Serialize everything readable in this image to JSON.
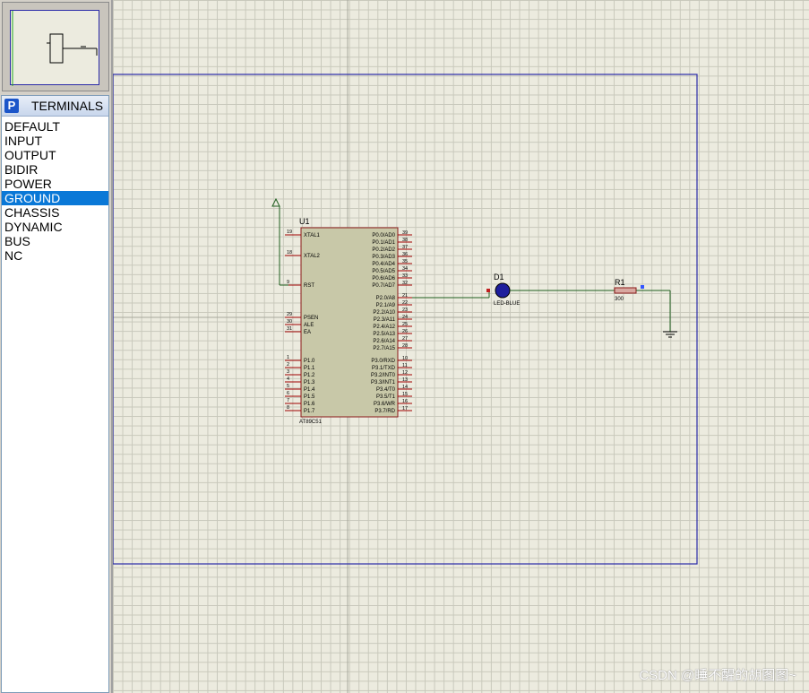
{
  "terminals_panel": {
    "mode_button": "P",
    "title": "TERMINALS",
    "items": [
      "DEFAULT",
      "INPUT",
      "OUTPUT",
      "BIDIR",
      "POWER",
      "GROUND",
      "CHASSIS",
      "DYNAMIC",
      "BUS",
      "NC"
    ],
    "selected": "GROUND"
  },
  "schematic": {
    "u1": {
      "ref": "U1",
      "part": "AT89C51",
      "left_pins": [
        {
          "num": "19",
          "name": "XTAL1"
        },
        {
          "num": "18",
          "name": "XTAL2"
        },
        {
          "num": "9",
          "name": "RST"
        },
        {
          "num": "29",
          "name": "PSEN"
        },
        {
          "num": "30",
          "name": "ALE"
        },
        {
          "num": "31",
          "name": "EA"
        },
        {
          "num": "1",
          "name": "P1.0"
        },
        {
          "num": "2",
          "name": "P1.1"
        },
        {
          "num": "3",
          "name": "P1.2"
        },
        {
          "num": "4",
          "name": "P1.3"
        },
        {
          "num": "5",
          "name": "P1.4"
        },
        {
          "num": "6",
          "name": "P1.5"
        },
        {
          "num": "7",
          "name": "P1.6"
        },
        {
          "num": "8",
          "name": "P1.7"
        }
      ],
      "right_pins": [
        {
          "num": "39",
          "name": "P0.0/AD0"
        },
        {
          "num": "38",
          "name": "P0.1/AD1"
        },
        {
          "num": "37",
          "name": "P0.2/AD2"
        },
        {
          "num": "36",
          "name": "P0.3/AD3"
        },
        {
          "num": "35",
          "name": "P0.4/AD4"
        },
        {
          "num": "34",
          "name": "P0.5/AD5"
        },
        {
          "num": "33",
          "name": "P0.6/AD6"
        },
        {
          "num": "32",
          "name": "P0.7/AD7"
        },
        {
          "num": "21",
          "name": "P2.0/A8"
        },
        {
          "num": "22",
          "name": "P2.1/A9"
        },
        {
          "num": "23",
          "name": "P2.2/A10"
        },
        {
          "num": "24",
          "name": "P2.3/A11"
        },
        {
          "num": "25",
          "name": "P2.4/A12"
        },
        {
          "num": "26",
          "name": "P2.5/A13"
        },
        {
          "num": "27",
          "name": "P2.6/A14"
        },
        {
          "num": "28",
          "name": "P2.7/A15"
        },
        {
          "num": "10",
          "name": "P3.0/RXD"
        },
        {
          "num": "11",
          "name": "P3.1/TXD"
        },
        {
          "num": "12",
          "name": "P3.2/INT0"
        },
        {
          "num": "13",
          "name": "P3.3/INT1"
        },
        {
          "num": "14",
          "name": "P3.4/T0"
        },
        {
          "num": "15",
          "name": "P3.5/T1"
        },
        {
          "num": "16",
          "name": "P3.6/WR"
        },
        {
          "num": "17",
          "name": "P3.7/RD"
        }
      ]
    },
    "d1": {
      "ref": "D1",
      "value": "LED-BLUE"
    },
    "r1": {
      "ref": "R1",
      "value": "300"
    }
  },
  "watermark": "CSDN @睡不醒的胡图图~",
  "colors": {
    "canvas": "#ecebdf",
    "grid": "#c8c8bb",
    "sheet_border": "#2a2aa8",
    "chip_fill": "#c8c8a8",
    "chip_border": "#8b1a1a",
    "wire": "#1f5f1f",
    "pin": "#a00000",
    "led": "#1e1e9c",
    "selection": "#0a78d7"
  },
  "icons": [
    "power-terminal-icon",
    "ground-terminal-icon",
    "led-icon",
    "resistor-icon"
  ]
}
